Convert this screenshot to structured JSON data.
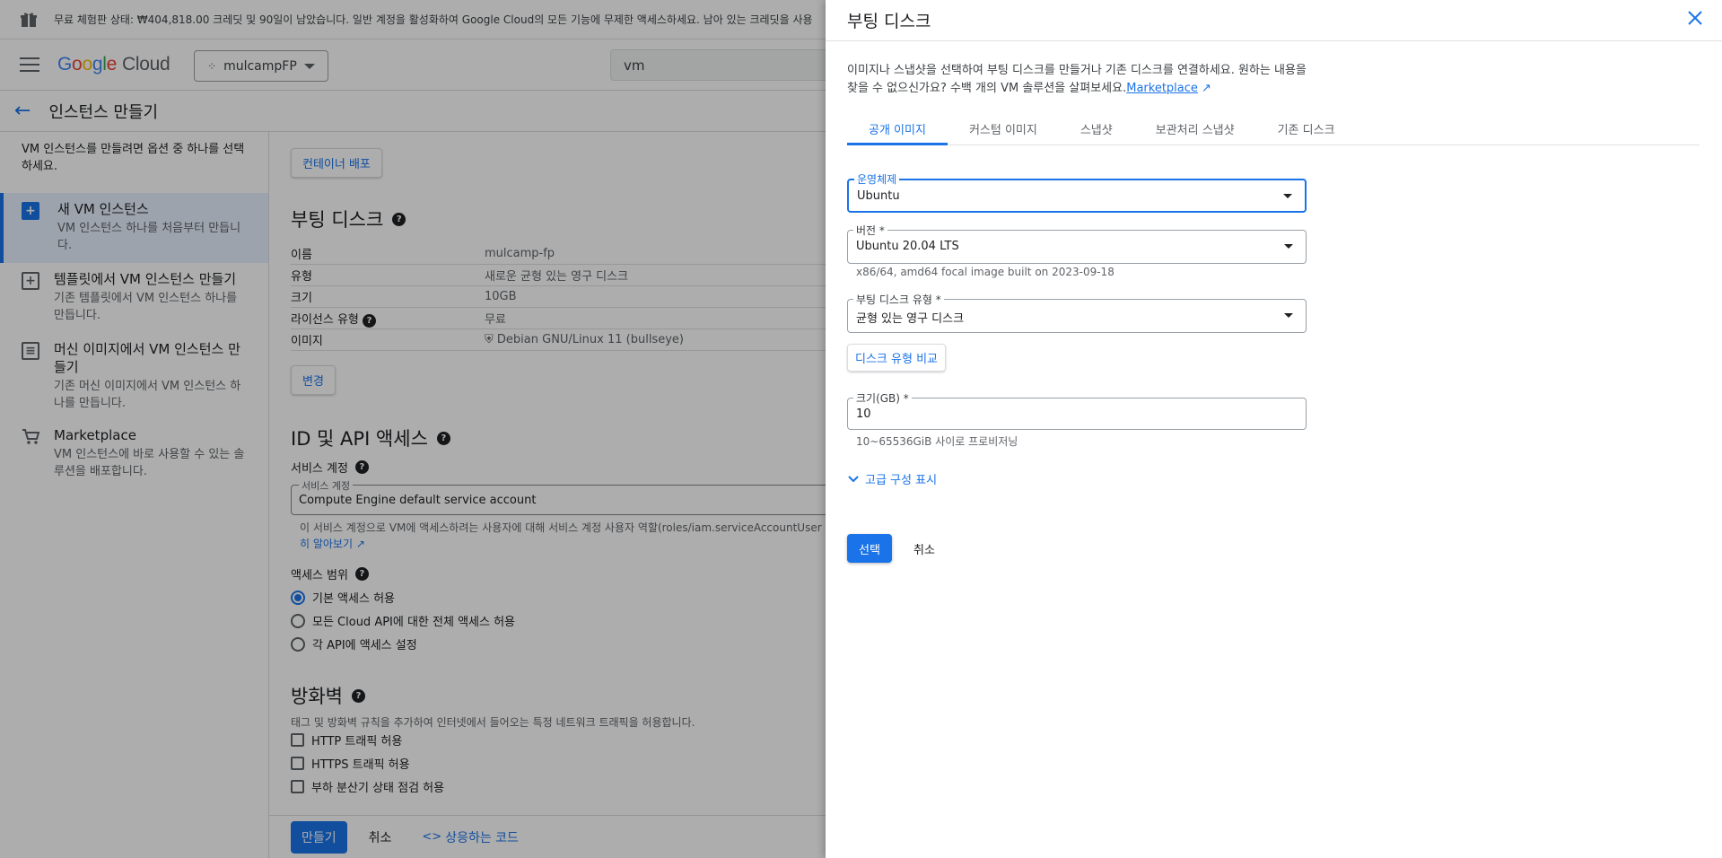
{
  "banner": {
    "text": "무료 체험판 상태: ₩404,818.00 크레딧 및 90일이 남았습니다. 일반 계정을 활성화하여 Google Cloud의 모든 기능에 무제한 액세스하세요. 남아 있는 크레딧을 사용"
  },
  "topbar": {
    "logo_google": [
      "G",
      "o",
      "o",
      "g",
      "l",
      "e"
    ],
    "logo_cloud": "Cloud",
    "project": "mulcampFP",
    "search_value": "vm"
  },
  "page": {
    "title": "인스턴스 만들기"
  },
  "leftnav": {
    "intro": "VM 인스턴스를 만들려면 옵션 중 하나를 선택하세요.",
    "items": [
      {
        "title": "새 VM 인스턴스",
        "desc": "VM 인스턴스 하나를 처음부터 만듭니다.",
        "icon": "+"
      },
      {
        "title": "템플릿에서 VM 인스턴스 만들기",
        "desc": "기존 템플릿에서 VM 인스턴스 하나를 만듭니다.",
        "icon": "+"
      },
      {
        "title": "머신 이미지에서 VM 인스턴스 만들기",
        "desc": "기존 머신 이미지에서 VM 인스턴스 하나를 만듭니다.",
        "icon": "≡"
      },
      {
        "title": "Marketplace",
        "desc": "VM 인스턴스에 바로 사용할 수 있는 솔루션을 배포합니다.",
        "icon": "cart"
      }
    ]
  },
  "main": {
    "container_deploy": "컨테이너 배포",
    "boot_disk_title": "부팅 디스크",
    "boot_rows": [
      {
        "k": "이름",
        "v": "mulcamp-fp"
      },
      {
        "k": "유형",
        "v": "새로운 균형 있는 영구 디스크"
      },
      {
        "k": "크기",
        "v": "10GB"
      },
      {
        "k": "라이선스 유형",
        "v": "무료"
      },
      {
        "k": "이미지",
        "v": "Debian GNU/Linux 11 (bullseye)"
      }
    ],
    "change_btn": "변경",
    "id_api_title": "ID 및 API 액세스",
    "service_account_label": "서비스 계정",
    "service_account_field_label": "서비스 계정",
    "service_account_value": "Compute Engine default service account",
    "service_account_hint": "이 서비스 계정으로 VM에 액세스하려는 사용자에 대해 서비스 계정 사용자 역할(roles/iam.serviceAccountUser",
    "learn_more": "히 알아보기",
    "access_scope_label": "액세스 범위",
    "scopes": [
      "기본 액세스 허용",
      "모든 Cloud API에 대한 전체 액세스 허용",
      "각 API에 액세스 설정"
    ],
    "firewall_title": "방화벽",
    "firewall_desc": "태그 및 방화벽 규칙을 추가하여 인터넷에서 들어오는 특정 네트워크 트래픽을 허용합니다.",
    "firewall_opts": [
      "HTTP 트래픽 허용",
      "HTTPS 트래픽 허용",
      "부하 분산기 상태 점검 허용"
    ]
  },
  "bottombar": {
    "create": "만들기",
    "cancel": "취소",
    "code": "상응하는 코드"
  },
  "panel": {
    "title": "부팅 디스크",
    "desc": "이미지나 스냅샷을 선택하여 부팅 디스크를 만들거나 기존 디스크를 연결하세요. 원하는 내용을 찾을 수 없으신가요? 수백 개의 VM 솔루션을 살펴보세요.",
    "marketplace_link": "Marketplace",
    "tabs": [
      "공개 이미지",
      "커스텀 이미지",
      "스냅샷",
      "보관처리 스냅샷",
      "기존 디스크"
    ],
    "os_label": "운영체제",
    "os_value": "Ubuntu",
    "version_label": "버전 *",
    "version_value": "Ubuntu 20.04 LTS",
    "version_hint": "x86/64, amd64 focal image built on 2023-09-18",
    "disk_type_label": "부팅 디스크 유형 *",
    "disk_type_value": "균형 있는 영구 디스크",
    "compare_btn": "디스크 유형 비교",
    "size_label": "크기(GB) *",
    "size_value": "10",
    "size_hint": "10~65536GiB 사이로 프로비저닝",
    "advanced": "고급 구성 표시",
    "select_btn": "선택",
    "cancel_btn": "취소"
  }
}
